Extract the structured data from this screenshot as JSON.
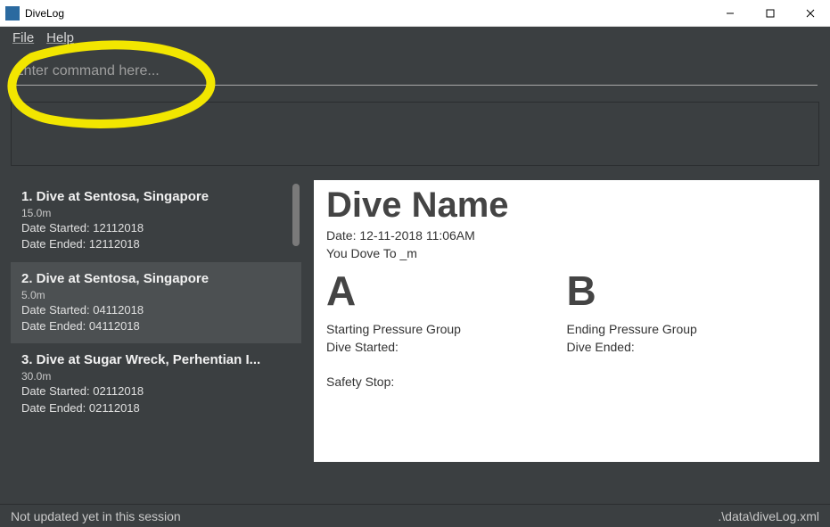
{
  "window": {
    "title": "DiveLog"
  },
  "menu": {
    "file": "File",
    "help": "Help"
  },
  "command": {
    "placeholder": "Enter command here..."
  },
  "list": [
    {
      "title": "1.   Dive at Sentosa, Singapore",
      "depth": "15.0m",
      "date_started": "Date Started: 12112018",
      "date_ended": "Date Ended: 12112018"
    },
    {
      "title": "2.   Dive at Sentosa, Singapore",
      "depth": "5.0m",
      "date_started": "Date Started: 04112018",
      "date_ended": "Date Ended: 04112018"
    },
    {
      "title": "3.   Dive at Sugar Wreck, Perhentian I...",
      "depth": "30.0m",
      "date_started": "Date Started: 02112018",
      "date_ended": "Date Ended: 02112018"
    }
  ],
  "detail": {
    "title": "Dive Name",
    "date": "Date: 12-11-2018 11:06AM",
    "depth_line": "You Dove To _m",
    "group_a": "A",
    "group_b": "B",
    "start_pg_label": "Starting Pressure Group",
    "end_pg_label": "Ending Pressure Group",
    "dive_started": "Dive Started:",
    "dive_ended": "Dive Ended:",
    "safety_stop": "Safety Stop:"
  },
  "status": {
    "left": "Not updated yet in this session",
    "right": ".\\data\\diveLog.xml"
  }
}
